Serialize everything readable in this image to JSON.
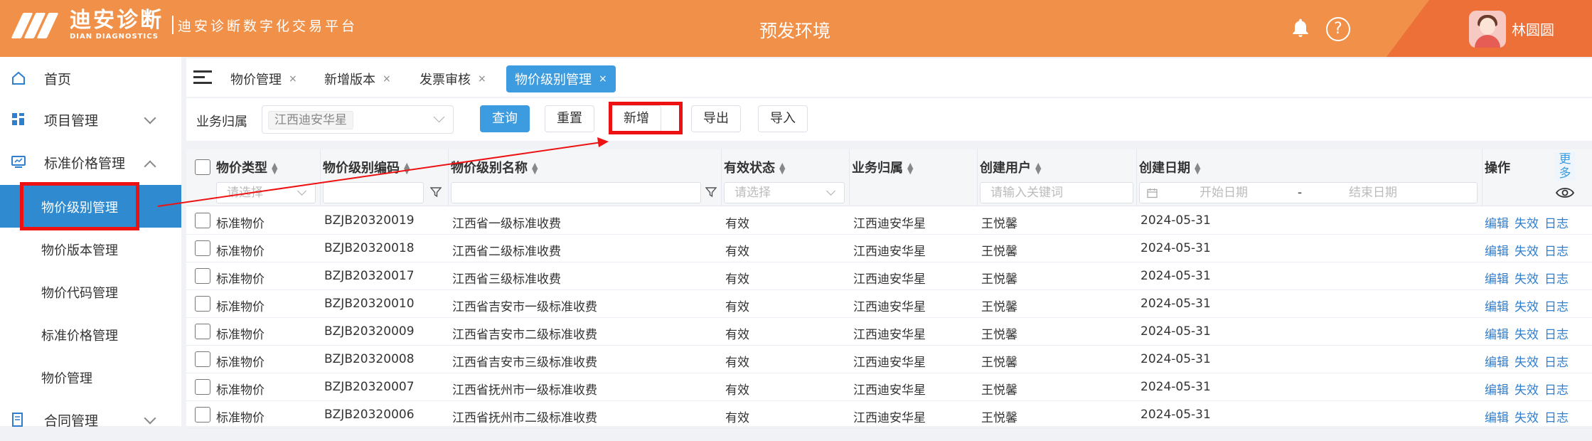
{
  "header": {
    "logo_cn": "迪安诊断",
    "logo_en": "DIAN DIAGNOSTICS",
    "platform": "迪安诊断数字化交易平台",
    "env_title": "预发环境",
    "username": "林圆圆",
    "help_glyph": "?"
  },
  "sidebar": {
    "items": [
      {
        "label": "首页"
      },
      {
        "label": "项目管理"
      },
      {
        "label": "标准价格管理"
      },
      {
        "label": "物价级别管理"
      },
      {
        "label": "物价版本管理"
      },
      {
        "label": "物价代码管理"
      },
      {
        "label": "标准价格管理"
      },
      {
        "label": "物价管理"
      },
      {
        "label": "合同管理"
      }
    ]
  },
  "tabs": [
    {
      "label": "物价管理",
      "close": "×"
    },
    {
      "label": "新增版本",
      "close": "×"
    },
    {
      "label": "发票审核",
      "close": "×"
    },
    {
      "label": "物价级别管理",
      "close": "×"
    }
  ],
  "filter": {
    "label": "业务归属",
    "selected_tag": "江西迪安华星",
    "buttons": {
      "query": "查询",
      "reset": "重置",
      "add": "新增",
      "export": "导出",
      "import": "导入"
    }
  },
  "table": {
    "columns": [
      "物价类型",
      "物价级别编码",
      "物价级别名称",
      "有效状态",
      "业务归属",
      "创建用户",
      "创建日期",
      "操作"
    ],
    "more_label": "更多",
    "filters": {
      "type_placeholder": "请选择",
      "status_placeholder": "请选择",
      "user_placeholder": "请输入关键词",
      "date_start": "开始日期",
      "date_sep": "-",
      "date_end": "结束日期"
    },
    "actions": {
      "edit": "编辑",
      "disable": "失效",
      "log": "日志"
    },
    "rows": [
      [
        "标准物价",
        "BZJB20320019",
        "江西省一级标准收费",
        "有效",
        "江西迪安华星",
        "王悦馨",
        "2024-05-31"
      ],
      [
        "标准物价",
        "BZJB20320018",
        "江西省二级标准收费",
        "有效",
        "江西迪安华星",
        "王悦馨",
        "2024-05-31"
      ],
      [
        "标准物价",
        "BZJB20320017",
        "江西省三级标准收费",
        "有效",
        "江西迪安华星",
        "王悦馨",
        "2024-05-31"
      ],
      [
        "标准物价",
        "BZJB20320010",
        "江西省吉安市一级标准收费",
        "有效",
        "江西迪安华星",
        "王悦馨",
        "2024-05-31"
      ],
      [
        "标准物价",
        "BZJB20320009",
        "江西省吉安市二级标准收费",
        "有效",
        "江西迪安华星",
        "王悦馨",
        "2024-05-31"
      ],
      [
        "标准物价",
        "BZJB20320008",
        "江西省吉安市三级标准收费",
        "有效",
        "江西迪安华星",
        "王悦馨",
        "2024-05-31"
      ],
      [
        "标准物价",
        "BZJB20320007",
        "江西省抚州市一级标准收费",
        "有效",
        "江西迪安华星",
        "王悦馨",
        "2024-05-31"
      ],
      [
        "标准物价",
        "BZJB20320006",
        "江西省抚州市二级标准收费",
        "有效",
        "江西迪安华星",
        "王悦馨",
        "2024-05-31"
      ]
    ]
  },
  "colors": {
    "header": "#f19149",
    "primary": "#3d9be0",
    "active_menu": "#2f8ad0",
    "annotation": "#ee1111",
    "link": "#2f7fd0"
  }
}
